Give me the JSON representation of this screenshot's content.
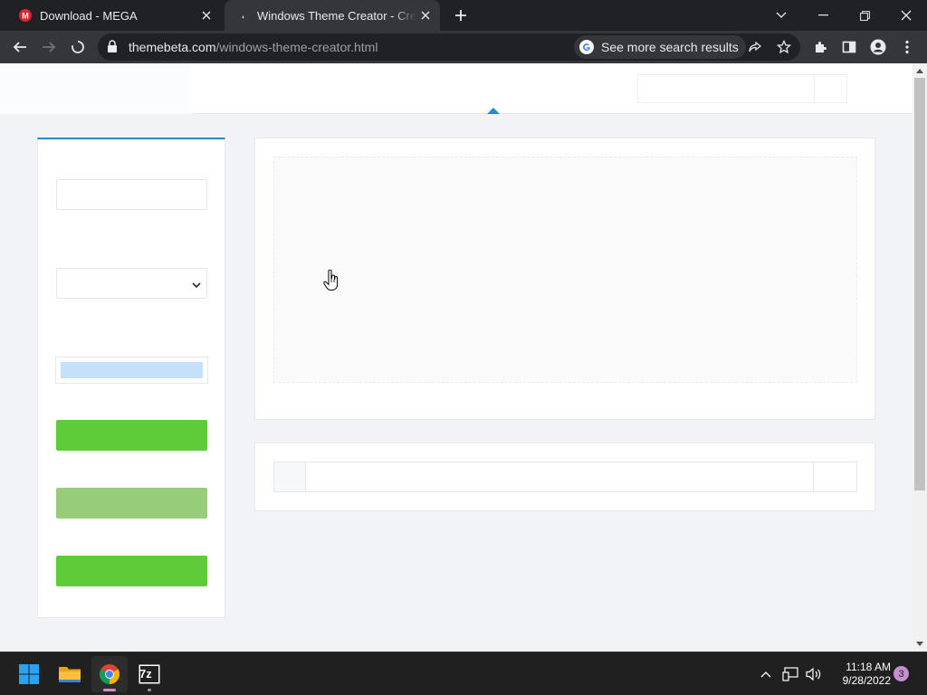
{
  "browser": {
    "tabs": [
      {
        "title": "Download - MEGA",
        "favicon": "mega-icon"
      },
      {
        "title": "Windows Theme Creator - Create",
        "favicon": "loading-icon"
      }
    ],
    "url": {
      "host": "themebeta.com",
      "path": "/windows-theme-creator.html"
    },
    "search_chip": "See more search results",
    "colors": {
      "frame": "#202124",
      "toolbar": "#35363a",
      "text": "#e8eaed"
    }
  },
  "page": {
    "colors": {
      "background": "#f1f3f6",
      "accent": "#2b86c5",
      "green_button": "#5ecb38",
      "light_green_button": "#97cd78",
      "file_fill": "#c5e0fb"
    }
  },
  "taskbar": {
    "apps": [
      "windows-start-icon",
      "file-explorer-icon",
      "chrome-icon",
      "7zip-icon"
    ],
    "seven_zip_label": "7z",
    "time": "11:18 AM",
    "date": "9/28/2022",
    "notification_count": "3"
  }
}
